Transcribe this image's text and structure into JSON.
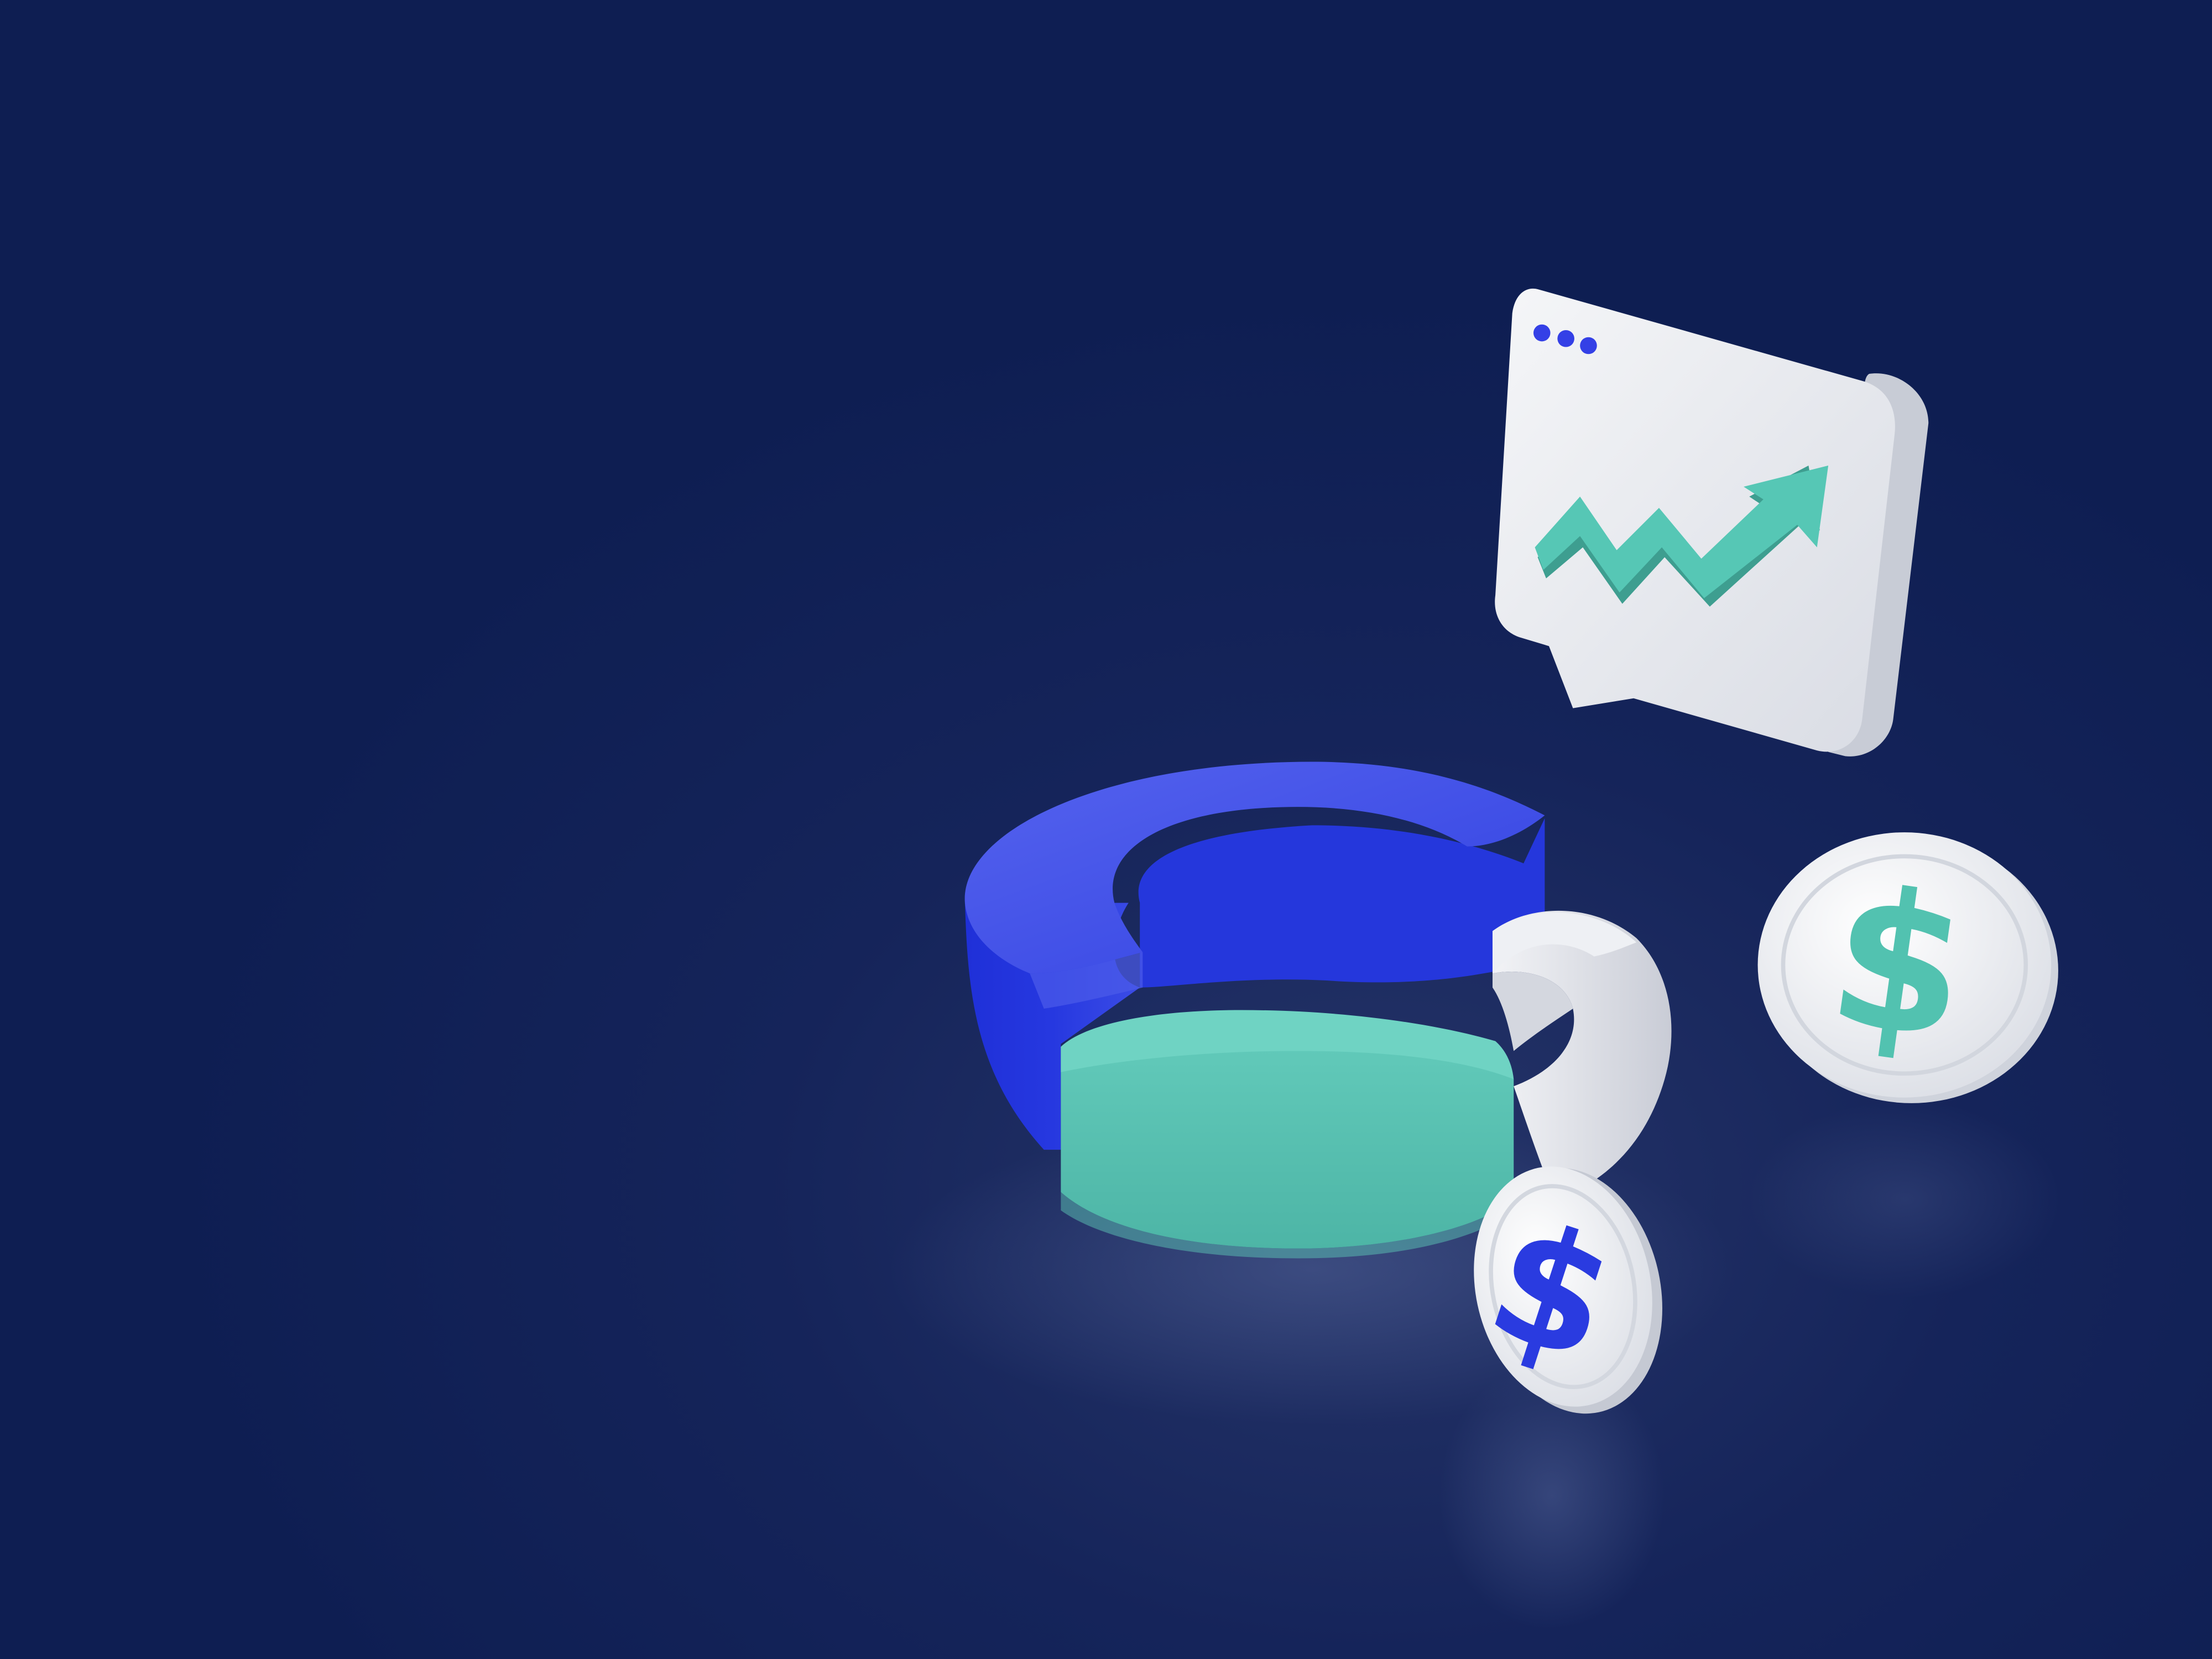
{
  "scene": {
    "background_color": "#0e1e52",
    "elements": [
      "donut-chart-3d",
      "chart-speech-bubble",
      "dollar-coin-large",
      "dollar-coin-small"
    ]
  },
  "donut_chart": {
    "segment_colors": {
      "blue": "#2b3fe0",
      "teal": "#5ec4b4",
      "white": "#e6e8ee"
    }
  },
  "speech_bubble": {
    "dot_count": 3,
    "dot_color": "#3440e6",
    "arrow_color": "#52c2b0",
    "arrow_icon": "trend-up-icon"
  },
  "coins": {
    "large": {
      "symbol": "$",
      "symbol_color": "#52c2b0"
    },
    "small": {
      "symbol": "$",
      "symbol_color": "#2a3be0"
    }
  }
}
